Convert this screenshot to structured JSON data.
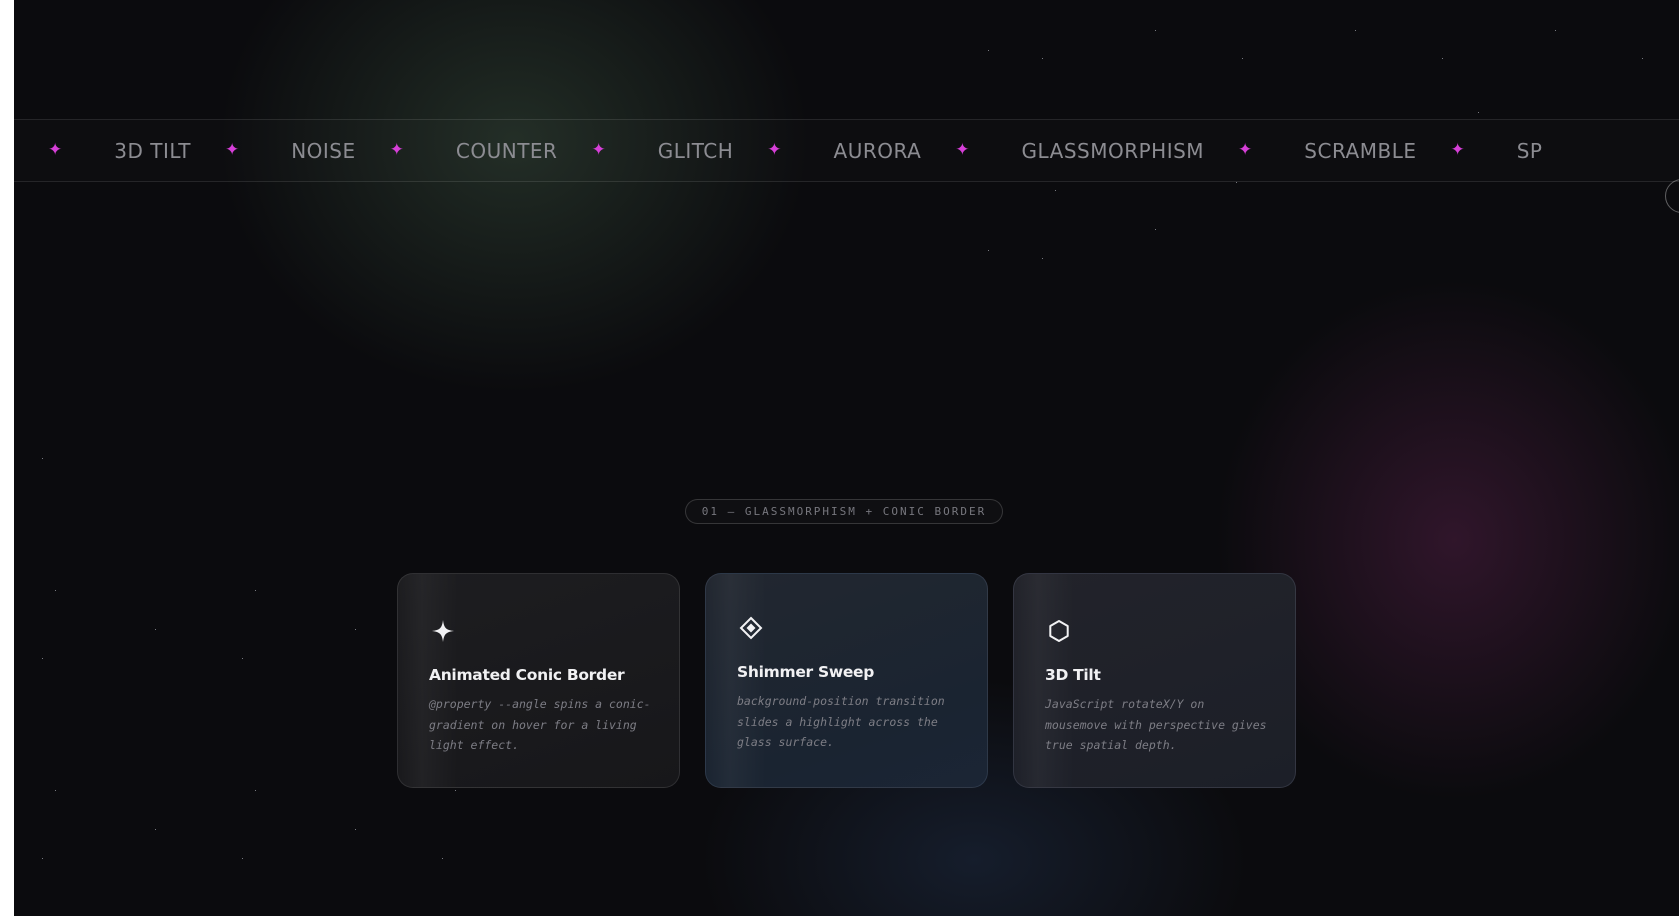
{
  "marquee": {
    "items": [
      "3D TILT",
      "NOISE",
      "COUNTER",
      "GLITCH",
      "AURORA",
      "GLASSMORPHISM",
      "SCRAMBLE",
      "SP"
    ],
    "separator": "✦"
  },
  "section": {
    "label": "01 — GLASSMORPHISM + CONIC BORDER"
  },
  "cards": [
    {
      "icon": "four-point-star-icon",
      "title": "Animated Conic Border",
      "description": "@property --angle spins a conic-gradient on hover for a living light effect."
    },
    {
      "icon": "diamond-icon",
      "title": "Shimmer Sweep",
      "description": "background-position transition slides a highlight across the glass surface."
    },
    {
      "icon": "hexagon-icon",
      "title": "3D Tilt",
      "description": "JavaScript rotateX/Y on mousemove with perspective gives true spatial depth."
    }
  ],
  "colors": {
    "background": "#0b0b0e",
    "accent_star": "#d63fd8",
    "marquee_text": "#8c8c92",
    "card_title": "#f1f1f3",
    "card_desc": "#7d7d85"
  }
}
